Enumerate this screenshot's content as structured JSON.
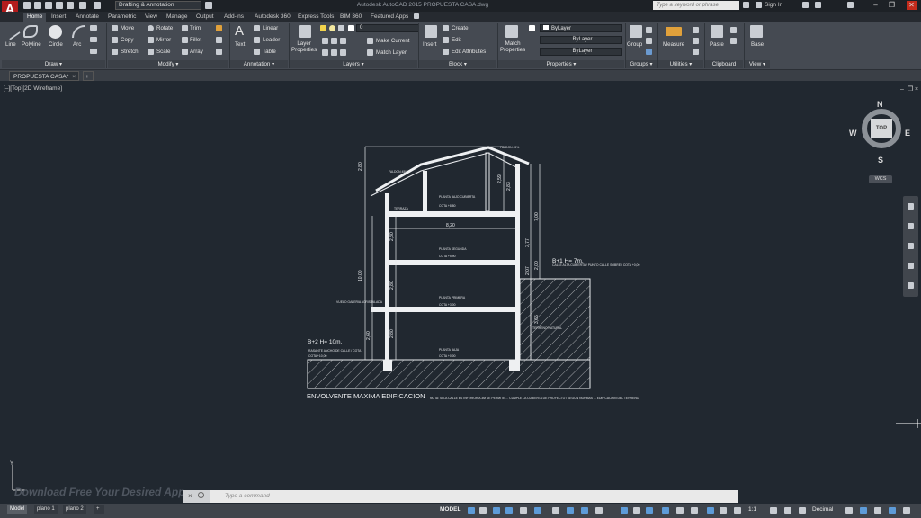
{
  "app": {
    "window_title": "Autodesk AutoCAD 2015   PROPUESTA CASA.dwg",
    "workspace": "Drafting & Annotation",
    "search_placeholder": "Type a keyword or phrase",
    "sign_in": "Sign In",
    "logo_letter": "A"
  },
  "ribbon": {
    "tabs": [
      "Home",
      "Insert",
      "Annotate",
      "Parametric",
      "View",
      "Manage",
      "Output",
      "Add-ins",
      "Autodesk 360",
      "Express Tools",
      "BIM 360",
      "Featured Apps"
    ],
    "active_tab": "Home",
    "draw": {
      "title": "Draw",
      "line": "Line",
      "polyline": "Polyline",
      "circle": "Circle",
      "arc": "Arc"
    },
    "modify": {
      "title": "Modify",
      "move": "Move",
      "rotate": "Rotate",
      "trim": "Trim",
      "copy": "Copy",
      "mirror": "Mirror",
      "fillet": "Fillet",
      "stretch": "Stretch",
      "scale": "Scale",
      "array": "Array"
    },
    "annotation": {
      "title": "Annotation",
      "text": "Text",
      "linear": "Linear",
      "leader": "Leader",
      "table": "Table"
    },
    "layers": {
      "title": "Layers",
      "layer_properties": "Layer\nProperties",
      "current_layer": "0",
      "make_current": "Make Current",
      "match_layer": "Match Layer"
    },
    "block": {
      "title": "Block",
      "insert": "Insert",
      "create": "Create",
      "edit": "Edit",
      "edit_attributes": "Edit Attributes"
    },
    "properties": {
      "title": "Properties",
      "match_properties": "Match\nProperties",
      "color": "ByLayer",
      "linetype": "ByLayer",
      "lineweight": "ByLayer"
    },
    "groups": {
      "title": "Groups",
      "group": "Group"
    },
    "utilities": {
      "title": "Utilities",
      "measure": "Measure"
    },
    "clipboard": {
      "title": "Clipboard",
      "paste": "Paste"
    },
    "view": {
      "title": "View",
      "base": "Base"
    }
  },
  "document_tabs": {
    "active": "PROPUESTA CASA*"
  },
  "viewport": {
    "label": "[–][Top][2D Wireframe]",
    "compass": {
      "n": "N",
      "s": "S",
      "e": "E",
      "w": "W",
      "top": "TOP",
      "wcs": "WCS"
    }
  },
  "drawing": {
    "title": "ENVOLVENTE MAXIMA EDIFICACION",
    "note_b2": "B+2 H= 10m.",
    "note_b1": "B+1 H= 7m.",
    "dims": {
      "roof": "2,80",
      "attic": "2,59",
      "attic2": "2,83",
      "width": "8,20",
      "total": "10,00",
      "floor2": "2,80",
      "floor1": "2,80",
      "ground": "2,80",
      "left_ground": "2,60",
      "right1": "3,77",
      "right2": "2,00",
      "right3": "2,07",
      "right4": "3,65",
      "roof_right": "7,00"
    },
    "labels": {
      "planta_bajo_cubierta": "PLANTA BAJO CUBIERTA",
      "planta_segunda": "PLANTA SEGUNDA",
      "planta_primera": "PLANTA PRIMERA",
      "planta_baja": "PLANTA BAJA",
      "terraza": "TERRAZA",
      "cota1": "COTA +8,80",
      "cota2": "COTA +5,90",
      "cota3": "COTA +3,00",
      "cota4": "COTA +0,00",
      "cota5": "COTA +10,00",
      "vuelo": "VUELO GALERIA ACRISTALADA",
      "faldon_left": "FALDON 45%",
      "faldon_right": "FALDON 45%",
      "calle_alta": "CALLE ALTA CUBIERTA / PUNTO CALLE SOBRE / COTA +0,00",
      "terreno": "TERRENO NATURAL",
      "rasante": "RASANTE ANCHO DE CALLE / COTA",
      "nota": "NOTA: SI LA CALLE ES INFERIOR A 3M SE PERMITE ... CUMPLE LA CUBIERTA DE PROYECTO / SEGUN NORMAS ... EDIFICACION DEL TERRENO"
    }
  },
  "command_line": {
    "placeholder": "Type a command"
  },
  "watermark": "Download Free Your Desired App",
  "layout_tabs": [
    "Model",
    "plano 1",
    "plano 2"
  ],
  "status": {
    "model": "MODEL",
    "scale": "1:1",
    "units": "Decimal"
  }
}
